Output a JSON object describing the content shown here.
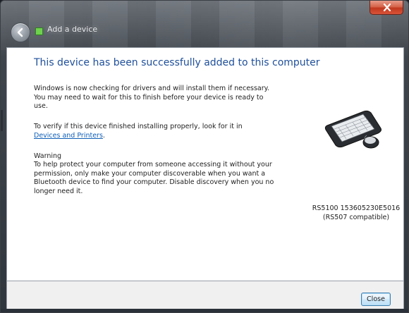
{
  "window": {
    "title": "Add a device",
    "icons": {
      "back": "back-arrow-icon",
      "title": "device-icon",
      "close": "close-icon"
    },
    "accent": "#1e4f9a",
    "link_color": "#0f5fb8"
  },
  "content": {
    "heading": "This device has been successfully added to this computer",
    "para1": "Windows is now checking for drivers and will install them if necessary. You may need to wait for this to finish before your device is ready to use.",
    "para2_prefix": "To verify if this device finished installing properly, look for it in",
    "para2_link": "Devices and Printers",
    "para2_suffix": ".",
    "warning_title": "Warning",
    "warning_body": "To help protect your computer from someone accessing it without your permission, only make your computer discoverable when you want a Bluetooth device to find your computer. Disable discovery when you no longer need it."
  },
  "device": {
    "icon": "keyboard-mouse-icon",
    "name_line1": "RS5100 153605230E5016",
    "name_line2": "(RS507 compatible)"
  },
  "footer": {
    "close_label": "Close"
  }
}
